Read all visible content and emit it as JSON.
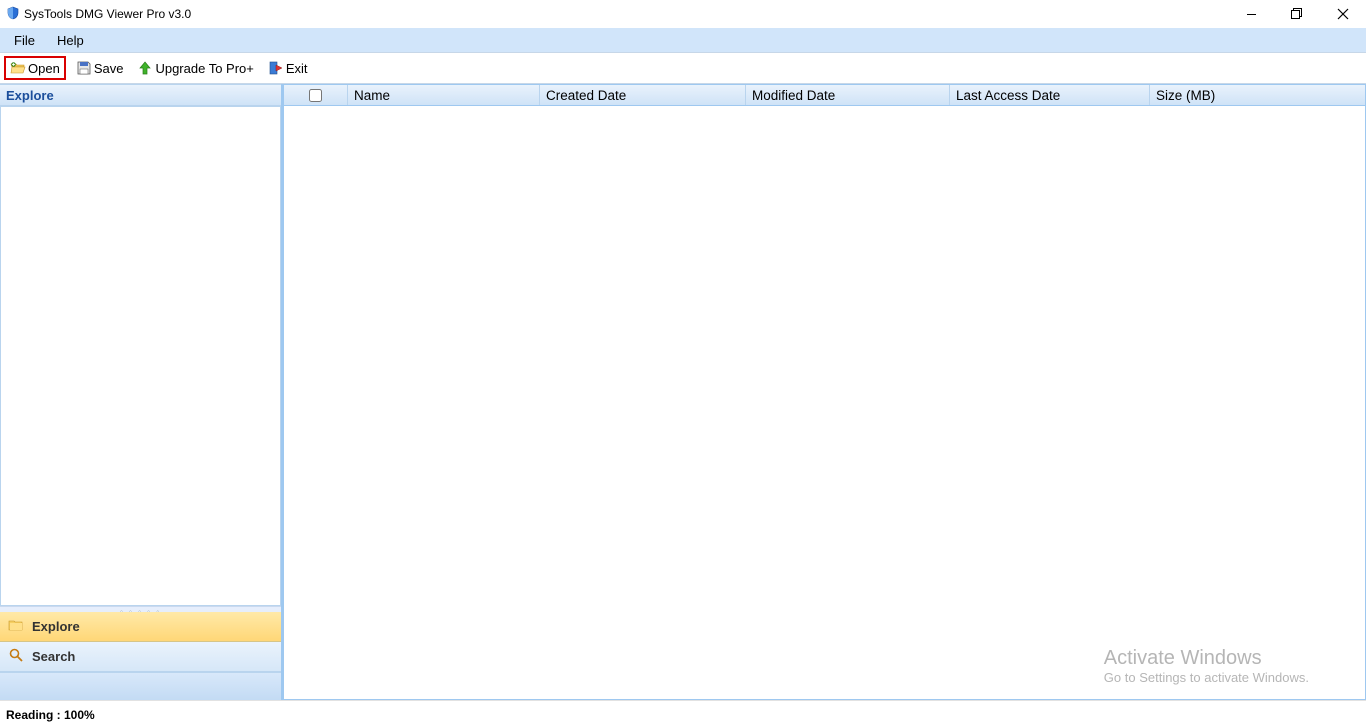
{
  "title": "SysTools DMG Viewer Pro v3.0",
  "menu": {
    "file": "File",
    "help": "Help"
  },
  "toolbar": {
    "open": "Open",
    "save": "Save",
    "upgrade": "Upgrade To Pro+",
    "exit": "Exit"
  },
  "sidebar": {
    "header": "Explore",
    "nav_explore": "Explore",
    "nav_search": "Search"
  },
  "grid": {
    "name": "Name",
    "created": "Created Date",
    "modified": "Modified Date",
    "access": "Last Access Date",
    "size": "Size (MB)"
  },
  "watermark": {
    "line1": "Activate Windows",
    "line2": "Go to Settings to activate Windows."
  },
  "status": "Reading : 100%"
}
